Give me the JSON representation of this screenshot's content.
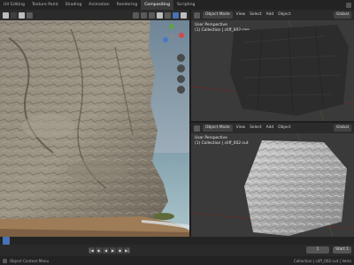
{
  "topbar": {
    "tabs": [
      "UV Editing",
      "Texture Paint",
      "Shading",
      "Animation",
      "Rendering",
      "Compositing",
      "Scripting"
    ],
    "active_index": 5
  },
  "left_viewport": {
    "icons": [
      "cursor-icon",
      "move-icon",
      "shading-solid-icon",
      "shading-material-icon",
      "overlay-icon"
    ]
  },
  "right_top": {
    "mode": "Object Mode",
    "menu": [
      "View",
      "Select",
      "Add",
      "Object"
    ],
    "orientation": "Global",
    "overlay_line1": "User Perspective",
    "overlay_line2": "(1) Collection | cliff_002-raw"
  },
  "right_bottom": {
    "mode": "Object Mode",
    "menu": [
      "View",
      "Select",
      "Add",
      "Object"
    ],
    "orientation": "Global",
    "overlay_line1": "User Perspective",
    "overlay_line2": "(1) Collection | cliff_002-cut"
  },
  "timeline": {
    "current_frame": "1",
    "start_label": "Start",
    "start_value": "1"
  },
  "statusbar": {
    "left": "Object Context Menu",
    "right": "Collection | cliff_002-cut | Verts"
  },
  "colors": {
    "accent": "#4772b3",
    "panel": "#2b2b2b",
    "viewport": "#3a3a3a"
  }
}
